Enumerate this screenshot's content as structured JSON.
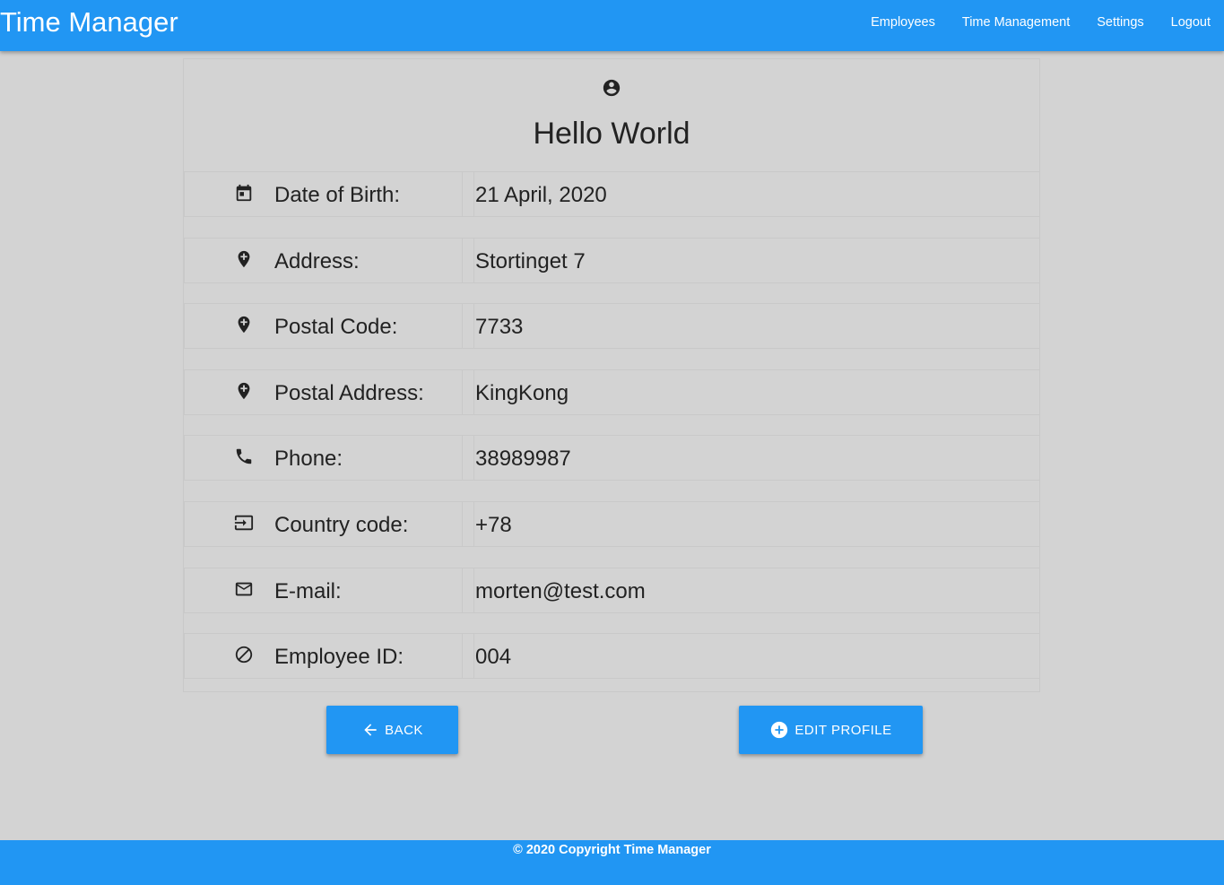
{
  "app": {
    "title": "Time Manager"
  },
  "nav": {
    "links": [
      "Employees",
      "Time Management",
      "Settings",
      "Logout"
    ]
  },
  "profile": {
    "icon": "account-circle-icon",
    "name": "Hello World",
    "fields": [
      {
        "icon": "calendar-icon",
        "label": "Date of Birth:",
        "value": "21 April, 2020"
      },
      {
        "icon": "location-pin-icon",
        "label": "Address:",
        "value": "Stortinget 7"
      },
      {
        "icon": "location-pin-icon",
        "label": "Postal Code:",
        "value": "7733"
      },
      {
        "icon": "location-pin-icon",
        "label": "Postal Address:",
        "value": "KingKong"
      },
      {
        "icon": "phone-icon",
        "label": "Phone:",
        "value": "38989987"
      },
      {
        "icon": "input-icon",
        "label": "Country code:",
        "value": "+78"
      },
      {
        "icon": "email-icon",
        "label": "E-mail:",
        "value": "morten@test.com"
      },
      {
        "icon": "block-icon",
        "label": "Employee ID:",
        "value": "004"
      }
    ]
  },
  "actions": {
    "back_label": "BACK",
    "back_icon": "arrow-left-icon",
    "edit_label": "EDIT PROFILE",
    "edit_icon": "add-circle-icon"
  },
  "footer": {
    "copyright": "© 2020 Copyright Time Manager"
  },
  "colors": {
    "primary": "#2196f3",
    "background": "#d3d3d3",
    "text": "#222222"
  }
}
